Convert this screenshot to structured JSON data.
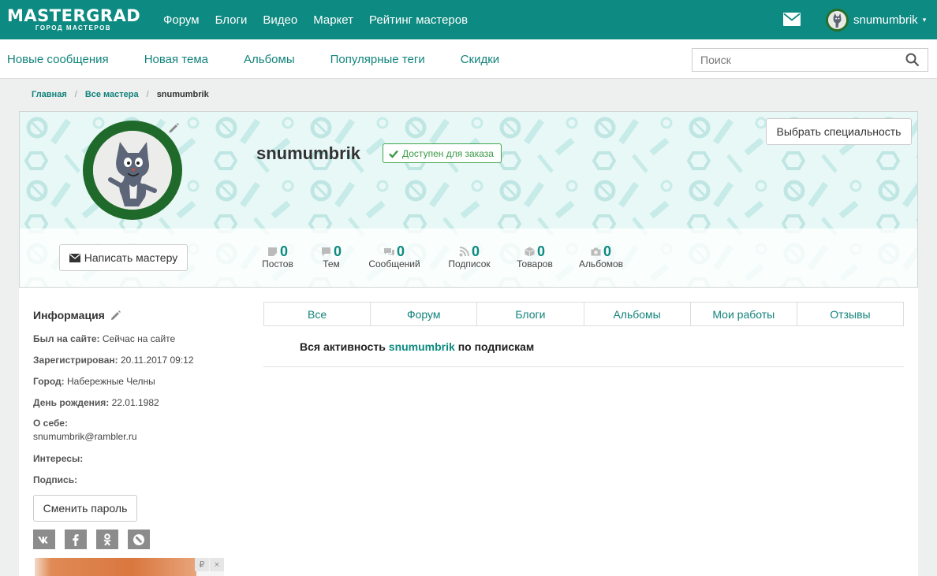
{
  "brand": {
    "logo_main": "MASTERGRAD",
    "logo_sub": "ГОРОД МАСТЕРОВ",
    "accent_color": "#0d8a81"
  },
  "topnav": [
    "Форум",
    "Блоги",
    "Видео",
    "Маркет",
    "Рейтинг мастеров"
  ],
  "user": {
    "name": "snumumbrik",
    "caret": "▾"
  },
  "subnav": [
    "Новые сообщения",
    "Новая тема",
    "Альбомы",
    "Популярные теги",
    "Скидки"
  ],
  "search": {
    "placeholder": "Поиск"
  },
  "breadcrumb": {
    "items": [
      "Главная",
      "Все мастера"
    ],
    "separator": "/",
    "current": "snumumbrik"
  },
  "profile": {
    "username": "snumumbrik",
    "status": "Доступен для заказа",
    "specialty_button": "Выбрать специальность",
    "write_button": "Написать мастеру",
    "stats": [
      {
        "count": "0",
        "label": "Постов",
        "icon": "post-icon"
      },
      {
        "count": "0",
        "label": "Тем",
        "icon": "topic-icon"
      },
      {
        "count": "0",
        "label": "Сообщений",
        "icon": "messages-icon"
      },
      {
        "count": "0",
        "label": "Подписок",
        "icon": "rss-icon"
      },
      {
        "count": "0",
        "label": "Товаров",
        "icon": "box-icon"
      },
      {
        "count": "0",
        "label": "Альбомов",
        "icon": "camera-icon"
      }
    ]
  },
  "info": {
    "title": "Информация",
    "last_seen_label": "Был на сайте:",
    "last_seen_value": "Сейчас на сайте",
    "registered_label": "Зарегистрирован:",
    "registered_value": "20.11.2017 09:12",
    "city_label": "Город:",
    "city_value": "Набережные Челны",
    "birthday_label": "День рождения:",
    "birthday_value": "22.01.1982",
    "about_label": "О себе:",
    "about_value": "snumumbrik@rambler.ru",
    "interests_label": "Интересы:",
    "signature_label": "Подпись:",
    "change_password": "Сменить пароль",
    "social": [
      "vk-icon",
      "facebook-icon",
      "odnoklassniki-icon",
      "livejournal-icon"
    ]
  },
  "ad": {
    "currency": "₽",
    "close": "×"
  },
  "tabs": [
    "Все",
    "Форум",
    "Блоги",
    "Альбомы",
    "Мои работы",
    "Отзывы"
  ],
  "activity": {
    "prefix": "Вся активность",
    "user": "snumumbrik",
    "suffix": "по подпискам"
  }
}
